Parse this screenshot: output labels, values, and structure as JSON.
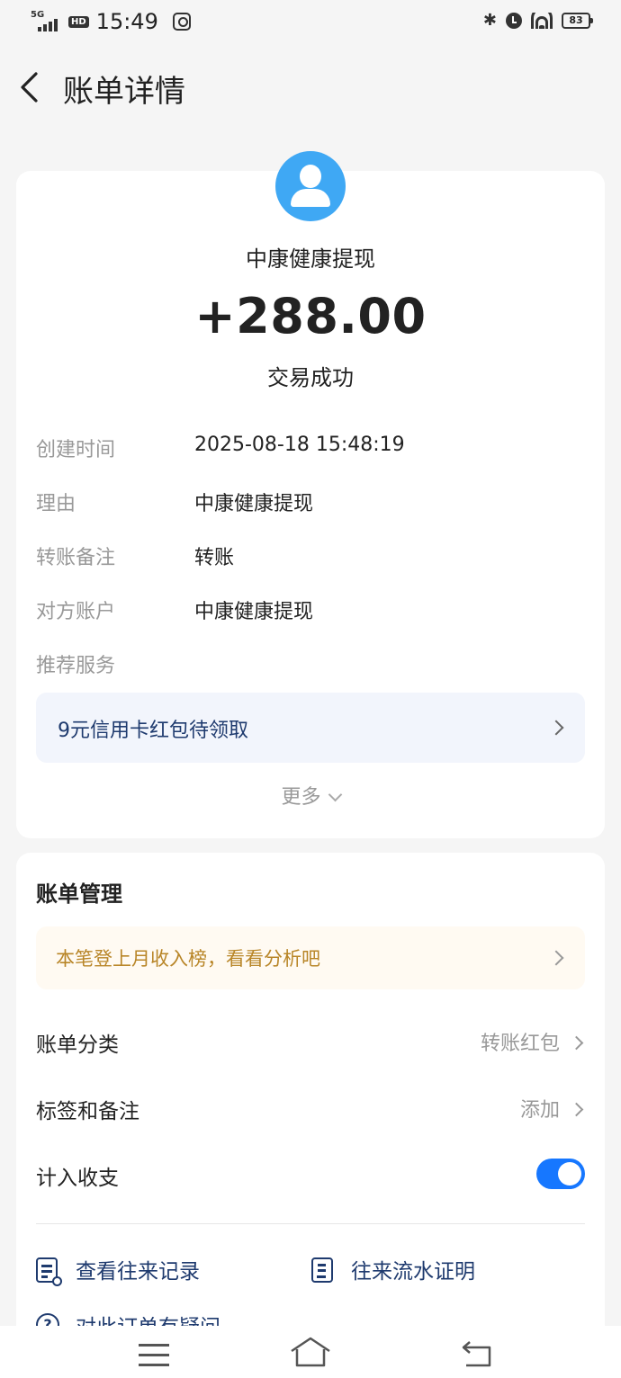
{
  "status_bar": {
    "network": "5G",
    "hd": "HD",
    "time": "15:49",
    "battery": "83"
  },
  "header": {
    "title": "账单详情"
  },
  "transaction": {
    "payee": "中康健康提现",
    "amount": "+288.00",
    "status": "交易成功",
    "details": [
      {
        "label": "创建时间",
        "value": "2025-08-18 15:48:19"
      },
      {
        "label": "理由",
        "value": "中康健康提现"
      },
      {
        "label": "转账备注",
        "value": "转账"
      },
      {
        "label": "对方账户",
        "value": "中康健康提现"
      },
      {
        "label": "推荐服务",
        "value": ""
      }
    ],
    "promo": "9元信用卡红包待领取",
    "more": "更多"
  },
  "manage": {
    "title": "账单管理",
    "notice": "本笔登上月收入榜，看看分析吧",
    "category_label": "账单分类",
    "category_value": "转账红包",
    "tag_label": "标签和备注",
    "tag_value": "添加",
    "count_label": "计入收支",
    "count_enabled": true,
    "action_records": "查看往来记录",
    "action_proof": "往来流水证明",
    "action_question": "对此订单有疑问"
  },
  "colors": {
    "accent": "#1677ff",
    "avatar": "#3fa8f4",
    "link_text": "#1e3a6e",
    "notice_text": "#b88527"
  }
}
